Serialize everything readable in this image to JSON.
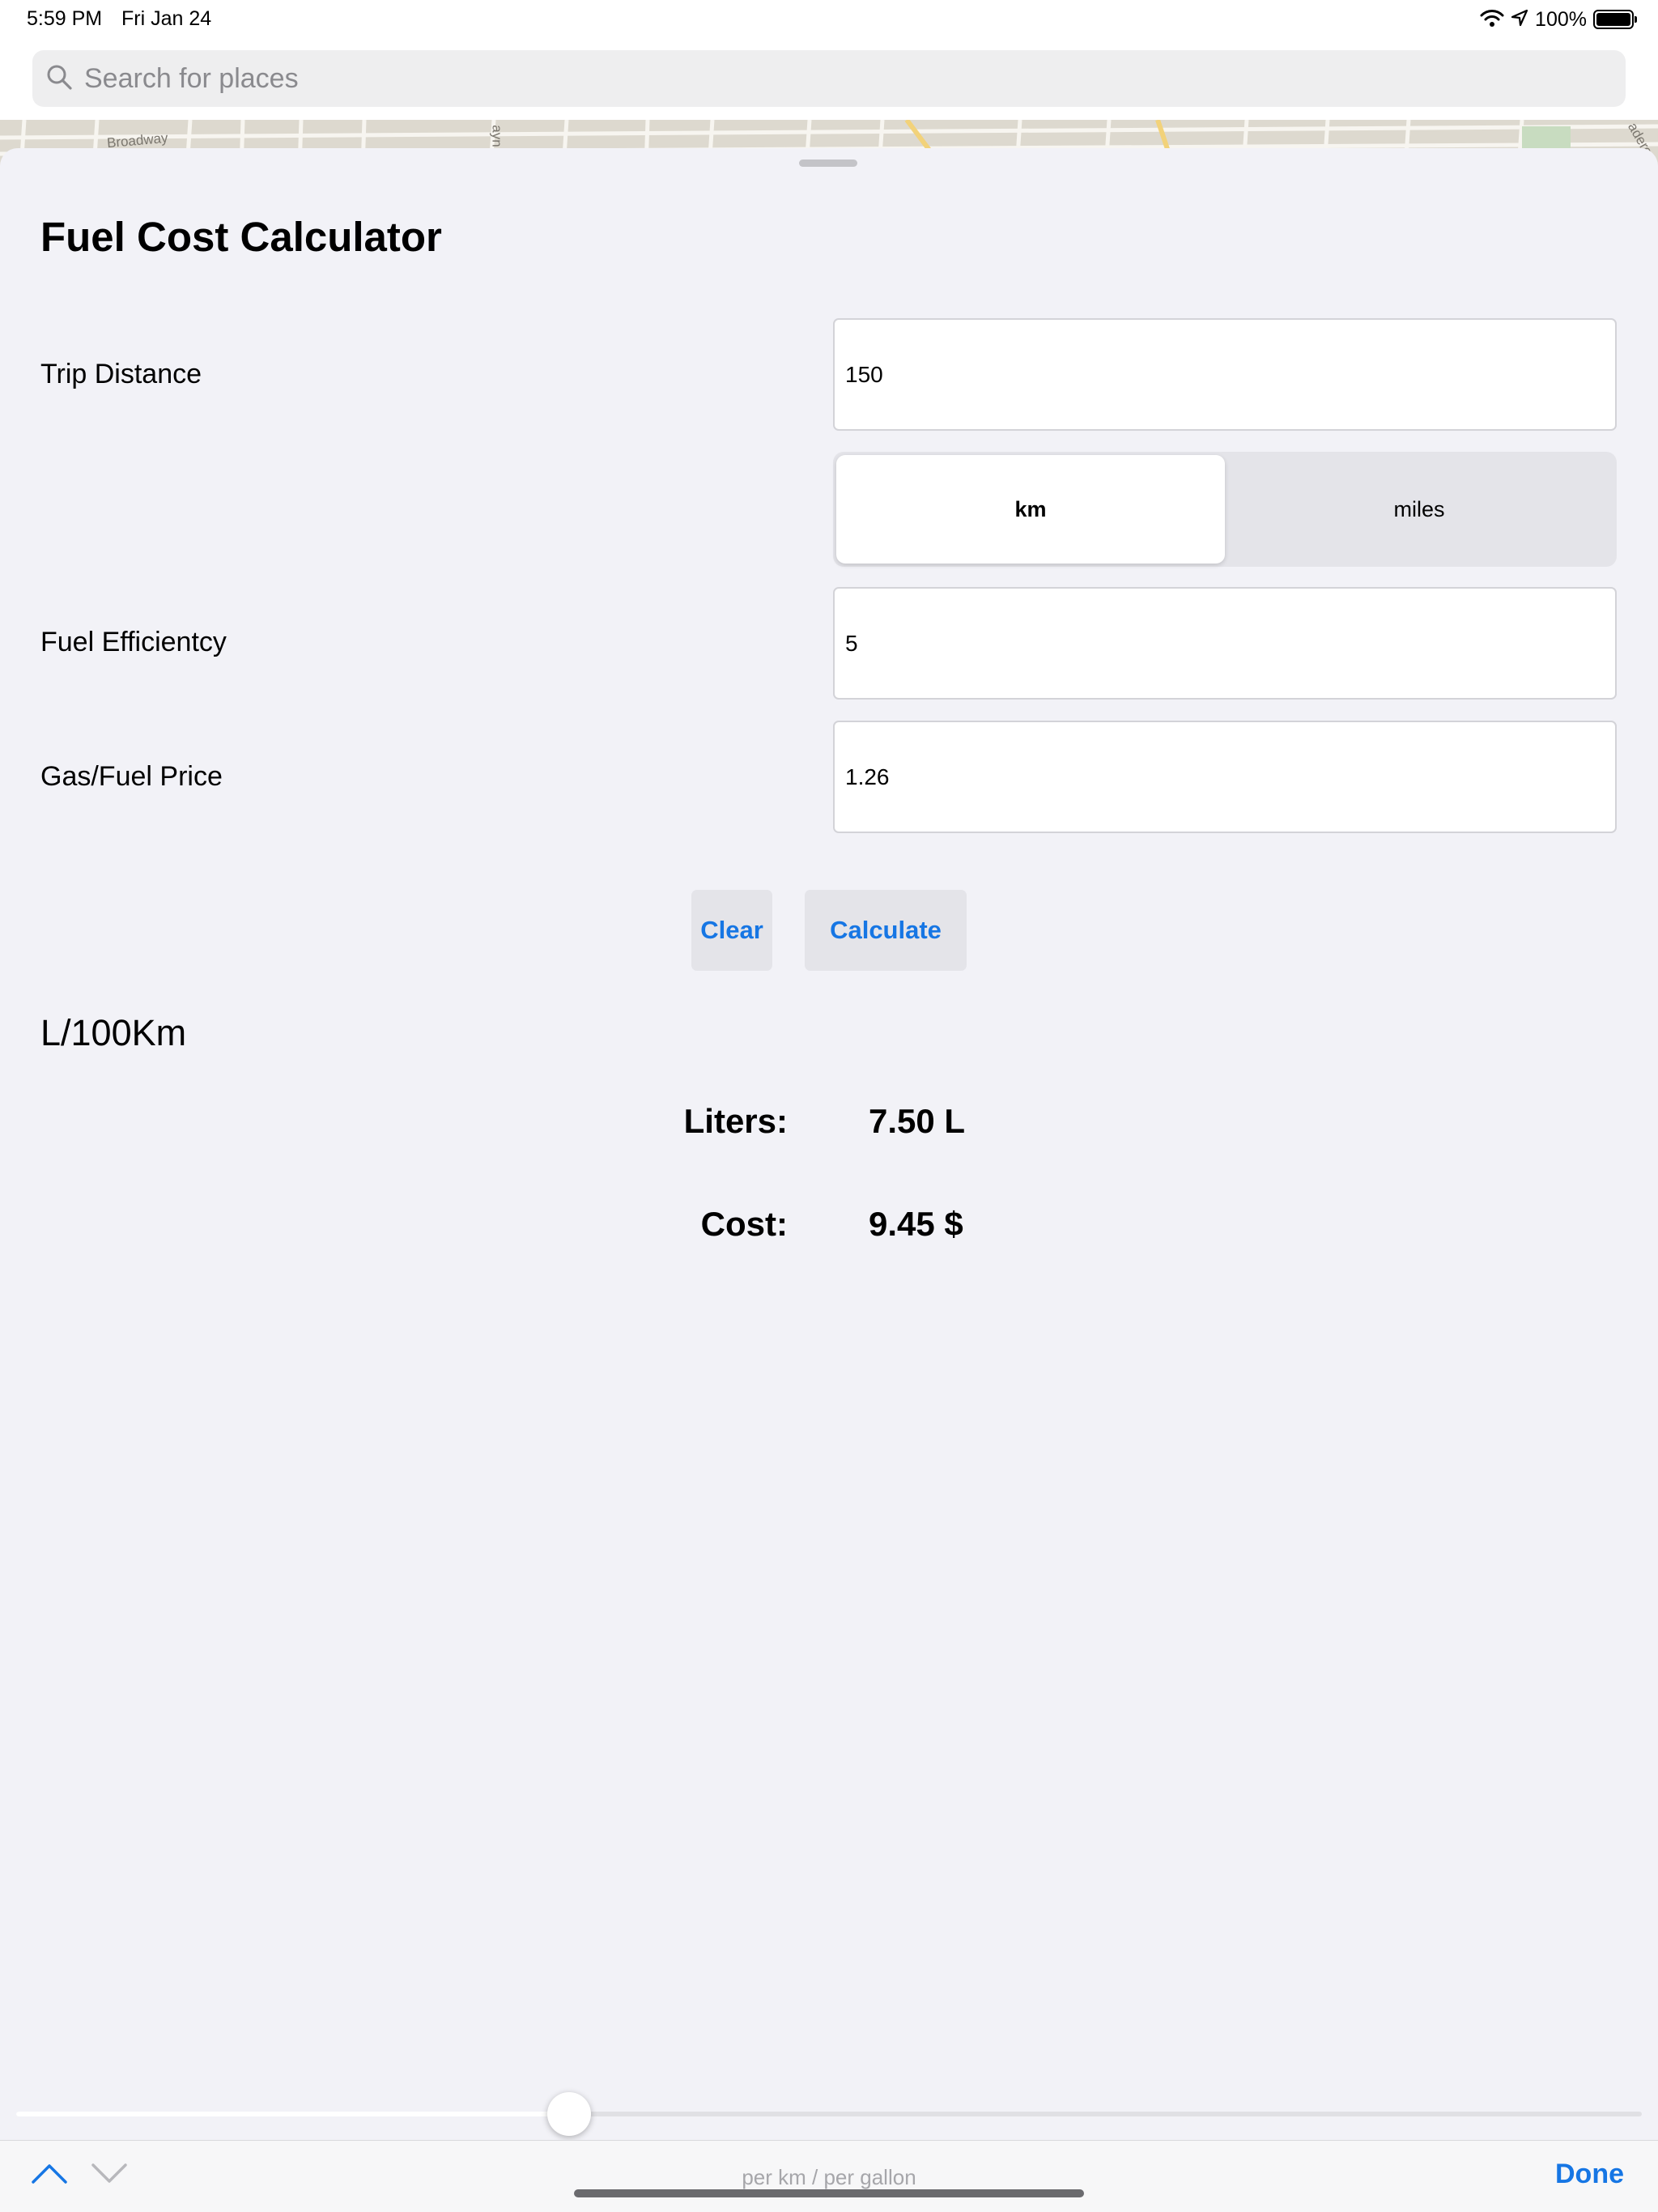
{
  "status_bar": {
    "time": "5:59 PM",
    "date": "Fri Jan 24",
    "battery": "100%",
    "battery_level": 1.0,
    "icons": [
      "wifi-icon",
      "location-arrow-icon",
      "battery-icon"
    ]
  },
  "search": {
    "placeholder": "Search for places",
    "icon": "search-icon"
  },
  "map": {
    "street_broadway": "Broadway",
    "street_partial_1": "ayn",
    "street_partial_2": "adero"
  },
  "sheet": {
    "title": "Fuel Cost Calculator",
    "trip_distance": {
      "label": "Trip Distance",
      "value": "150"
    },
    "distance_unit": {
      "options": [
        "km",
        "miles"
      ],
      "selected": "km"
    },
    "fuel_efficiency": {
      "label": "Fuel Efficientcy",
      "value": "5"
    },
    "fuel_price": {
      "label": "Gas/Fuel Price",
      "value": "1.26"
    },
    "buttons": {
      "clear": "Clear",
      "calculate": "Calculate"
    },
    "efficiency_unit": "L/100Km",
    "results": {
      "liters_label": "Liters:",
      "liters_value": "7.50 L",
      "cost_label": "Cost:",
      "cost_value": "9.45 $"
    }
  },
  "slider": {
    "value": 0.34
  },
  "toolbar": {
    "hint": "per km /  per gallon",
    "done": "Done",
    "prev_icon": "chevron-up-icon",
    "next_icon": "chevron-down-icon"
  },
  "colors": {
    "accent": "#1676e4",
    "background": "#f2f2f7"
  }
}
